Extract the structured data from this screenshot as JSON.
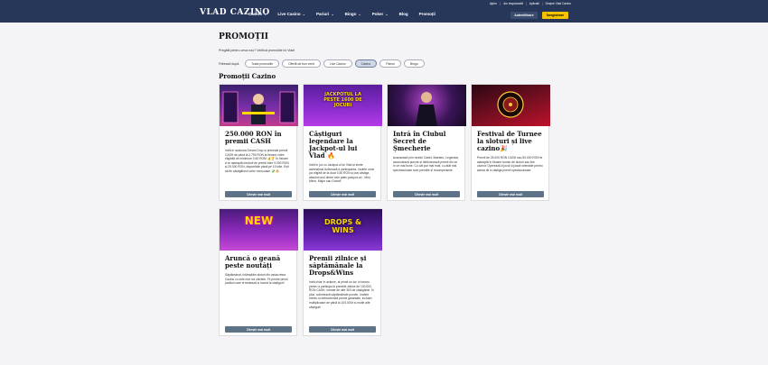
{
  "header": {
    "logo": "VLAD CAZINO",
    "nav": [
      {
        "label": "Casino",
        "has_dropdown": true
      },
      {
        "label": "Live Casino",
        "has_dropdown": true
      },
      {
        "label": "Pariuri",
        "has_dropdown": true
      },
      {
        "label": "Bingo",
        "has_dropdown": true
      },
      {
        "label": "Poker",
        "has_dropdown": true
      },
      {
        "label": "Blog",
        "has_dropdown": false
      },
      {
        "label": "Promoții",
        "has_dropdown": false
      }
    ],
    "utility_links": [
      "Ajutor",
      "Joc responsabil",
      "Aplicații",
      "Despre Vlad Cazino"
    ],
    "login_label": "Autentificare",
    "register_label": "Înregistrare",
    "colors": {
      "bar": "#27375a",
      "register": "#f5c400"
    }
  },
  "page": {
    "title": "PROMOȚII",
    "subtitle": "Pregătit pentru ceva nou? Verifică promoțiile lui Vlad!",
    "filter_label": "Filtrează după:",
    "filters": [
      "Toate promoțiile",
      "Ofertă de bun venit",
      "Live Casino",
      "Casino",
      "Pariuri",
      "Bingo"
    ],
    "active_filter": "Casino",
    "section_title": "Promoții Cazino"
  },
  "cards": [
    {
      "title": "250.000 RON în premii CASH",
      "description": "Intră în acțiunea Dream Drop și primește premii CASH de până la 2.750 RON la fiecare rotire eligibilă de minimum 0,50 RON! 💰🏆 În fiecare zi te așteaptă fondurii de premii între 9.000 RON și 25.000 RON, disponibile până pe 19 iulie. Ești să fie câștigătorul celor norocoase. 💸🔥",
      "cta": "Citește mai mult",
      "image_text": ""
    },
    {
      "title": "Câștiguri legendare la Jackpot-ul lui Vlad 🔥",
      "description": "Intră în joc cu Jackpot-ul lui Vlad și simte adrenalina! Activează-ți participarea, învârte orice joc eligibil de la doar 0,50 RON și poți câștiga absolut unul dintre cele patru jackpot-uri - Mini, Minor, Major sau Grand!",
      "cta": "Citește mai mult",
      "image_text": "JACKPOTUL LA PESTE 1600 DE JOCURI"
    },
    {
      "title": "Intră în Clubul Secret de Șmecherie",
      "description": "Avansează prin nivelul Cadet, Maestru, Legendar, acumulează puncte și deblochează premii din ce în ce mai bune. Cu cât joci mai mult, cu atât mai spectaculoase sunt premiile și recompensele.",
      "cta": "Citește mai mult",
      "image_text": ""
    },
    {
      "title": "Festival de Turnee la sloturi și live cazino🎉",
      "description": "Premii de 25.000 RON CASH sau 50.000 RON te așteaptă în fiecare turneu de sloturi sau live cazino! Operează-ți jocul și joacă selectate pentru șansa de a câștiga premii spectaculoase.",
      "cta": "Citește mai mult",
      "image_text": ""
    },
    {
      "title": "Aruncă o geană peste noutăți",
      "description": "Săptămânal, întâmplăm sloturi din vasta rețea Cazino cu cele mai noi ofertele. Fii printre primii jucători care le testează și luceră la câștiguri!",
      "cta": "Citește mai mult",
      "image_text": "NEW"
    },
    {
      "title": "Premii zilnice și săptămânale la Drops&Wins",
      "description": "Intră chiar în acțiune, ai primit un loc în turneu pentru a participa la premiile zilnice de 100.000 RON CASH, urmate de alte 300 de câștigători. În plus, colectează săptămânale puncte, învârte mereu și deblochează premii garantate, inclusiv multiplicatori de până la 100.000x și multe alte câștiguri!",
      "cta": "Citește mai mult",
      "image_text": "DROPS & WINS"
    }
  ]
}
